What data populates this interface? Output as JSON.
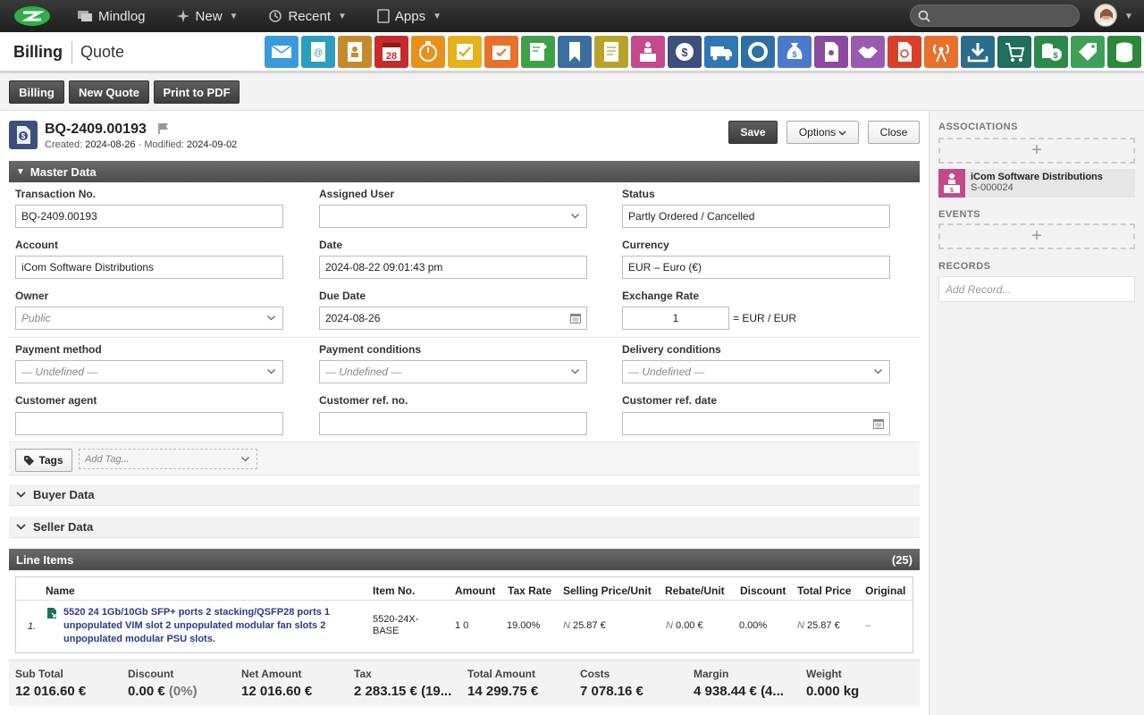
{
  "topbar": {
    "nav": [
      {
        "label": "Mindlog",
        "icon": "mindlog-icon"
      },
      {
        "label": "New",
        "icon": "sparkle-icon"
      },
      {
        "label": "Recent",
        "icon": "history-icon"
      },
      {
        "label": "Apps",
        "icon": "tablet-icon"
      }
    ],
    "search_placeholder": ""
  },
  "header": {
    "module": "Billing",
    "view": "Quote"
  },
  "module_icons": [
    {
      "name": "mail-icon",
      "color": "#3a9ad9"
    },
    {
      "name": "address-book-icon",
      "color": "#2a9fbf"
    },
    {
      "name": "contacts-icon",
      "color": "#c58a2b"
    },
    {
      "name": "calendar-icon",
      "color": "#c62a2a"
    },
    {
      "name": "stopwatch-icon",
      "color": "#e8901a"
    },
    {
      "name": "tasks-icon",
      "color": "#e5b21c"
    },
    {
      "name": "checklist-folder-icon",
      "color": "#e8702a"
    },
    {
      "name": "notes-icon",
      "color": "#3fa04a"
    },
    {
      "name": "bookmark-icon",
      "color": "#3a6e9e"
    },
    {
      "name": "document-icon",
      "color": "#b8a32a"
    },
    {
      "name": "sales-desk-icon",
      "color": "#c44a8c"
    },
    {
      "name": "billing-dollar-icon",
      "color": "#3d4f7c"
    },
    {
      "name": "delivery-truck-icon",
      "color": "#2f78b5"
    },
    {
      "name": "support-icon",
      "color": "#2f6fa5"
    },
    {
      "name": "money-bag-icon",
      "color": "#4a7ac8"
    },
    {
      "name": "contract-icon",
      "color": "#8a4a9e"
    },
    {
      "name": "handshake-icon",
      "color": "#9a5ab0"
    },
    {
      "name": "pdf-icon",
      "color": "#d9402a"
    },
    {
      "name": "broadcast-icon",
      "color": "#e8702a"
    },
    {
      "name": "download-icon",
      "color": "#2a6e8e"
    },
    {
      "name": "cart-icon",
      "color": "#1f6f5a"
    },
    {
      "name": "cash-icon",
      "color": "#2a8a4a"
    },
    {
      "name": "price-tag-icon",
      "color": "#3fa05a"
    },
    {
      "name": "database-icon",
      "color": "#2a8a3a"
    }
  ],
  "toolbar": {
    "billing": "Billing",
    "new_quote": "New Quote",
    "print_pdf": "Print to PDF"
  },
  "record": {
    "number": "BQ-2409.00193",
    "created_label": "Created:",
    "created": "2024-08-26",
    "modified_label": "· Modified:",
    "modified": "2024-09-02",
    "save": "Save",
    "options": "Options",
    "close": "Close"
  },
  "master": {
    "title": "Master Data",
    "transaction_no": {
      "label": "Transaction No.",
      "value": "BQ-2409.00193"
    },
    "assigned_user": {
      "label": "Assigned User",
      "value": ""
    },
    "status": {
      "label": "Status",
      "value": "Partly Ordered / Cancelled"
    },
    "account": {
      "label": "Account",
      "value": "iCom Software Distributions"
    },
    "date": {
      "label": "Date",
      "value": "2024-08-22 09:01:43 pm"
    },
    "currency": {
      "label": "Currency",
      "value": "EUR – Euro (€)"
    },
    "owner": {
      "label": "Owner",
      "value": "Public"
    },
    "due_date": {
      "label": "Due Date",
      "value": "2024-08-26"
    },
    "exchange_rate": {
      "label": "Exchange Rate",
      "value": "1",
      "unit": "= EUR / EUR"
    },
    "payment_method": {
      "label": "Payment method",
      "value": "— Undefined —"
    },
    "payment_conditions": {
      "label": "Payment conditions",
      "value": "— Undefined —"
    },
    "delivery_conditions": {
      "label": "Delivery conditions",
      "value": "— Undefined —"
    },
    "customer_agent": {
      "label": "Customer agent",
      "value": ""
    },
    "customer_ref_no": {
      "label": "Customer ref. no.",
      "value": ""
    },
    "customer_ref_date": {
      "label": "Customer ref. date",
      "value": ""
    },
    "tags_button": "Tags",
    "tag_placeholder": "Add Tag..."
  },
  "buyer": {
    "title": "Buyer Data"
  },
  "seller": {
    "title": "Seller Data"
  },
  "lines": {
    "title": "Line Items",
    "count": "(25)",
    "headers": {
      "name": "Name",
      "item_no": "Item No.",
      "amount": "Amount",
      "tax_rate": "Tax Rate",
      "selling_price": "Selling Price/Unit",
      "rebate": "Rebate/Unit",
      "discount": "Discount",
      "total_price": "Total Price",
      "original": "Original"
    },
    "rows": [
      {
        "index": "1.",
        "name_line1": "5520 24 1Gb/10Gb SFP+ ports 2 stacking/QSFP28 ports 1",
        "name_line2": "unpopulated VIM slot 2 unpopulated modular fan slots 2",
        "name_line3": "unpopulated modular PSU slots.",
        "item_no_line1": "5520-24X-",
        "item_no_line2": "BASE",
        "amount": "1 0",
        "tax_rate": "19.00%",
        "selling_prefix": "N",
        "selling_price": "25.87 €",
        "rebate_prefix": "N",
        "rebate": "0.00 €",
        "discount": "0.00%",
        "total_prefix": "N",
        "total_price": "25.87 €",
        "original": "–"
      }
    ]
  },
  "totals": {
    "sub_total": {
      "label": "Sub Total",
      "value": "12 016.60 €"
    },
    "discount": {
      "label": "Discount",
      "value": "0.00 €",
      "pct": "(0%)"
    },
    "net_amount": {
      "label": "Net Amount",
      "value": "12 016.60 €"
    },
    "tax": {
      "label": "Tax",
      "value": "2 283.15 € (19..."
    },
    "total_amount": {
      "label": "Total Amount",
      "value": "14 299.75 €"
    },
    "costs": {
      "label": "Costs",
      "value": "7 078.16 €"
    },
    "margin": {
      "label": "Margin",
      "value": "4 938.44 € (4..."
    },
    "weight": {
      "label": "Weight",
      "value": "0.000 kg"
    }
  },
  "sidebar": {
    "associations": "ASSOCIATIONS",
    "assoc_item": {
      "name": "iCom Software Distributions",
      "code": "S-000024"
    },
    "events": "EVENTS",
    "records": "RECORDS",
    "add_record_placeholder": "Add Record..."
  }
}
